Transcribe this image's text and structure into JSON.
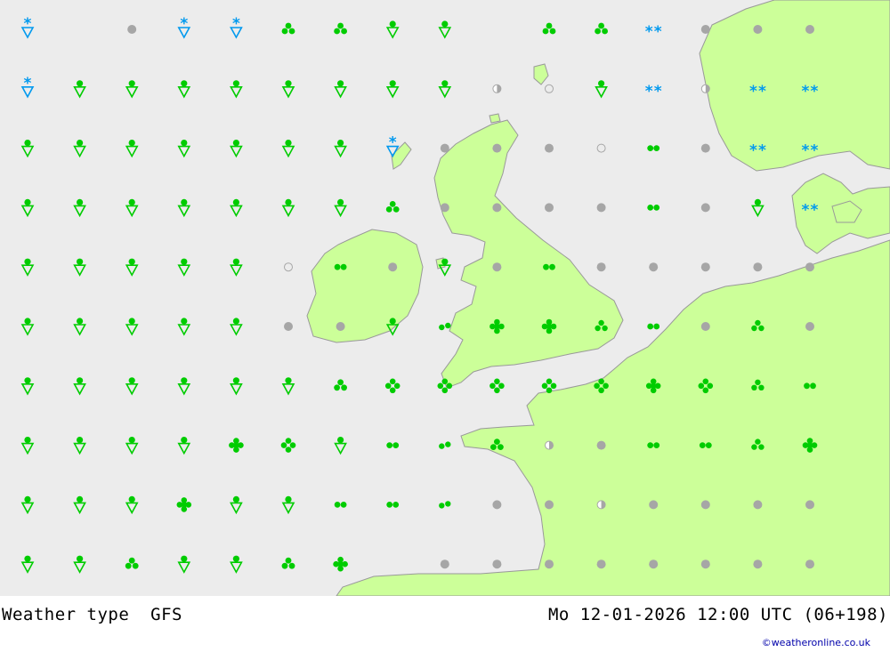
{
  "header": {
    "title": "Weather type  GFS",
    "datetime": "Mo 12-01-2026 12:00 UTC (06+198)",
    "credit": "©weatheronline.co.uk"
  },
  "colors": {
    "sea": "#ececec",
    "land": "#ccff99",
    "border": "#999999",
    "rain": "#00cc00",
    "snow": "#0099ee",
    "cloud": "#a6a6a6"
  },
  "legend_symbols": {
    "R": "rain-shower",
    "S": "snow-shower",
    "C": "heavy-rain-3dots",
    "D": "rain-2dots",
    "F": "rain-4dots",
    "G": "rain-5dots",
    "Q": "showery-rain-3dots",
    "P": "rain-2dots-diagonal",
    "W": "snow-double-star",
    "O": "overcast",
    "H": "half-cloudy",
    "E": "fair",
    ".": "none"
  },
  "weather_grid": [
    "S.OSSCCRR.CCWOOO",
    "SRRRRRRRRHERWHWW",
    "RRRRRRRSOOOEDOWW",
    "RRRRRRRCOOOODORW",
    "RRRRREDORODOOOOO",
    "RRRRROORPGGQDOQO",
    "RRRRRRCFFFFFGFQD",
    "RRRRGFRDPCHODDQG",
    "RRRGRRDDPOOHOOOO",
    "RRCRRCG.OOOOOOOO"
  ]
}
